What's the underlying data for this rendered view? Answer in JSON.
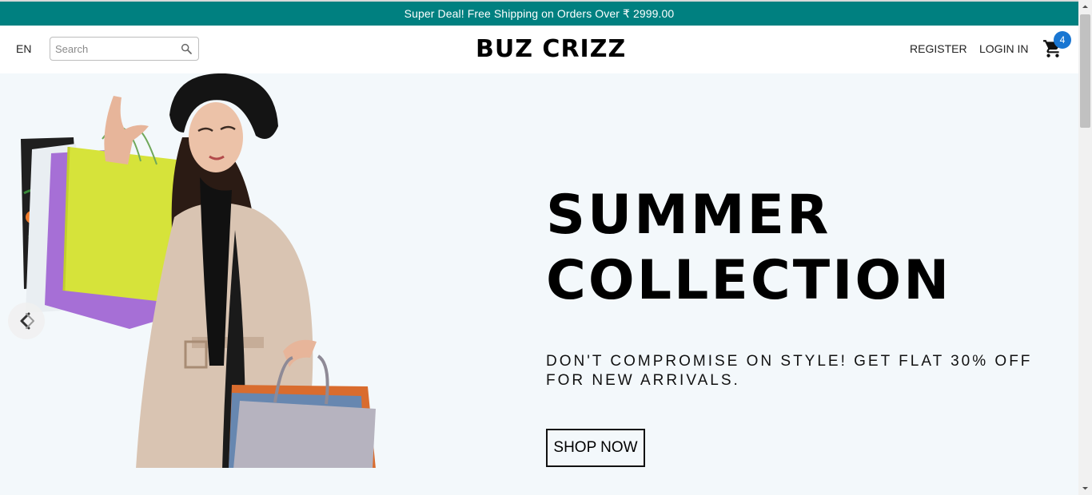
{
  "announcement": {
    "text": "Super Deal! Free Shipping on Orders Over ₹ 2999.00"
  },
  "header": {
    "language": "EN",
    "search": {
      "placeholder": "Search",
      "value": ""
    },
    "brand": "BUZ CRIZZ",
    "register": "REGISTER",
    "login": "LOGIN IN",
    "cart_count": "4"
  },
  "hero": {
    "title_line1": "SUMMER",
    "title_line2": "COLLECTION",
    "subtitle": "DON'T COMPROMISE ON STYLE! GET FLAT 30% OFF FOR NEW ARRIVALS.",
    "cta": "SHOP NOW"
  },
  "icons": {
    "search": "search-icon",
    "cart": "cart-icon",
    "slider_prev": "chevron-left-icon"
  },
  "colors": {
    "announcement_bg": "#008080",
    "hero_bg": "#f3f8fb",
    "badge_bg": "#1976d2"
  }
}
